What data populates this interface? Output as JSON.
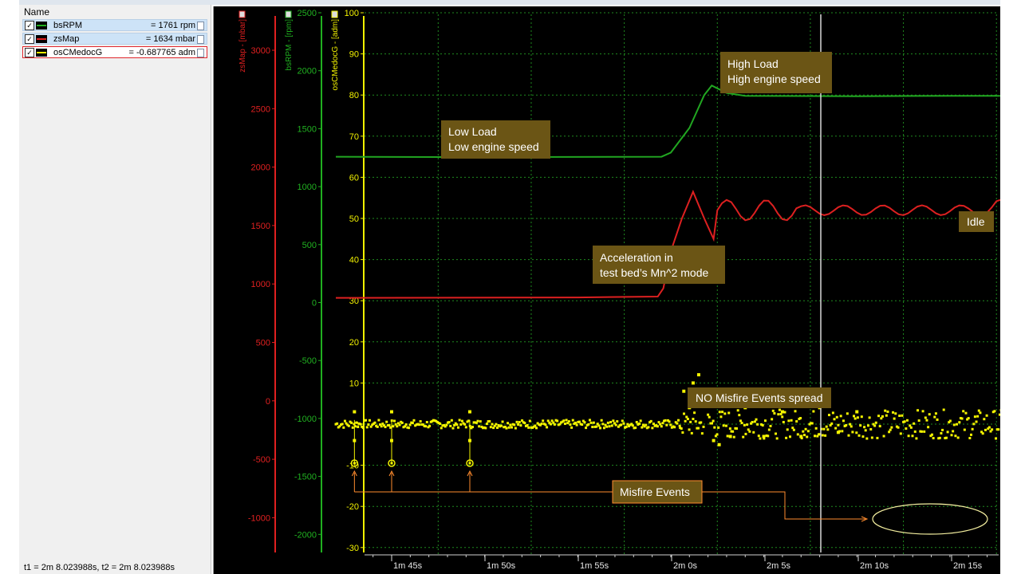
{
  "panel": {
    "header": "Name",
    "signals": [
      {
        "name": "bsRPM",
        "value": "= 1761 rpm",
        "color": "#20b020"
      },
      {
        "name": "zsMap",
        "value": "= 1634 mbar",
        "color": "#e02020"
      },
      {
        "name": "osCMedocG",
        "value": "= -0.687765 adm",
        "color": "#f2f200"
      }
    ],
    "status": "t1 = 2m 8.023988s, t2 = 2m 8.023988s"
  },
  "chart_data": {
    "type": "line",
    "axes": [
      {
        "label": "zsMap - [mbar]",
        "color": "#e02020",
        "range": [
          -1400,
          3400
        ],
        "ticks": [
          3000,
          2500,
          2000,
          1500,
          1000,
          500,
          0,
          -500,
          -1000
        ]
      },
      {
        "label": "bsRPM - [rpm]",
        "color": "#20b020",
        "range": [
          -2250,
          2500
        ],
        "ticks": [
          2500,
          2000,
          1500,
          1000,
          500,
          0,
          -500,
          -1000,
          -1500,
          -2000
        ]
      },
      {
        "label": "osCMedocG - [adm]",
        "color": "#f2f200",
        "range": [
          -30,
          100
        ],
        "ticks": [
          100,
          90,
          80,
          70,
          60,
          50,
          40,
          30,
          20,
          10,
          0,
          -10,
          -20,
          -30
        ]
      }
    ],
    "x_ticks": [
      "1m 45s",
      "1m 50s",
      "1m 55s",
      "2m 0s",
      "2m 5s",
      "2m 10s",
      "2m 15s"
    ],
    "cursor_time": "2m 8.023988s",
    "series": [
      {
        "name": "bsRPM",
        "color": "#21a621",
        "points": [
          [
            97,
            65
          ],
          [
            105,
            64.9
          ],
          [
            114.5,
            65
          ],
          [
            115,
            66
          ],
          [
            116,
            72
          ],
          [
            116.8,
            80
          ],
          [
            117.2,
            82.3
          ],
          [
            118,
            80.5
          ],
          [
            119,
            79.8
          ],
          [
            125,
            79.7
          ],
          [
            130,
            79.8
          ],
          [
            137,
            79.8
          ],
          [
            138,
            79.5
          ],
          [
            140,
            79.7
          ],
          [
            141,
            79.4
          ],
          [
            141.5,
            79.8
          ]
        ]
      },
      {
        "name": "zsMap",
        "color": "#dc2020",
        "points": [
          [
            97,
            30.7
          ],
          [
            110,
            30.8
          ],
          [
            114.3,
            31
          ],
          [
            114.6,
            33
          ],
          [
            115,
            42
          ],
          [
            115.6,
            50
          ],
          [
            116.2,
            56.5
          ],
          [
            116.8,
            50
          ],
          [
            117.3,
            45
          ],
          [
            118,
            51
          ],
          [
            119,
            54
          ],
          [
            120,
            50
          ],
          [
            121,
            53
          ],
          [
            122,
            51
          ],
          [
            125,
            52
          ],
          [
            130,
            52
          ],
          [
            132,
            52.5
          ],
          [
            133,
            53.5
          ],
          [
            135,
            54.5
          ],
          [
            138,
            55
          ],
          [
            140,
            53
          ],
          [
            141.5,
            54
          ]
        ]
      },
      {
        "name": "osCMedocG",
        "color": "#f5f500",
        "band_segments": [
          [
            97,
            115.5,
            2
          ],
          [
            115.5,
            116.8,
            6
          ],
          [
            117,
            141.5,
            7
          ]
        ],
        "spike_points": [
          [
            115.7,
            8
          ],
          [
            116.2,
            10
          ],
          [
            116.5,
            12
          ],
          [
            116,
            4
          ],
          [
            116.9,
            7
          ],
          [
            117.3,
            -4
          ],
          [
            117.6,
            -5
          ],
          [
            118.2,
            -3
          ],
          [
            119,
            4
          ],
          [
            120,
            -3
          ],
          [
            121,
            3
          ],
          [
            122,
            -3
          ],
          [
            123,
            4
          ],
          [
            124,
            -2
          ],
          [
            125,
            3
          ]
        ],
        "misfires": [
          [
            98.0,
            -9.5
          ],
          [
            100.0,
            -9.5
          ],
          [
            104.2,
            -9.5
          ]
        ],
        "late_drops": [
          [
            135.5,
            -22
          ],
          [
            136.5,
            -18
          ],
          [
            137.2,
            -23
          ],
          [
            138.6,
            -22
          ],
          [
            139.7,
            -20
          ],
          [
            140.5,
            -21
          ],
          [
            141.3,
            -23
          ]
        ],
        "late_peaks": [
          [
            135.6,
            9
          ],
          [
            136.6,
            10
          ],
          [
            137.2,
            8
          ],
          [
            138.2,
            9
          ],
          [
            139.0,
            11
          ],
          [
            140.6,
            9
          ]
        ]
      }
    ],
    "annotations": [
      {
        "text": [
          "Low Load",
          "Low engine speed"
        ]
      },
      {
        "text": [
          "High Load",
          "High engine speed"
        ]
      },
      {
        "text": [
          "Acceleration in",
          "test bed’s Mn^2 mode"
        ]
      },
      {
        "text": [
          "Idle"
        ]
      },
      {
        "text": [
          "NO Misfire Events spread"
        ]
      },
      {
        "text": [
          "Misfire Events"
        ]
      }
    ],
    "grid": true,
    "annotation_fill": "#6b5515"
  }
}
